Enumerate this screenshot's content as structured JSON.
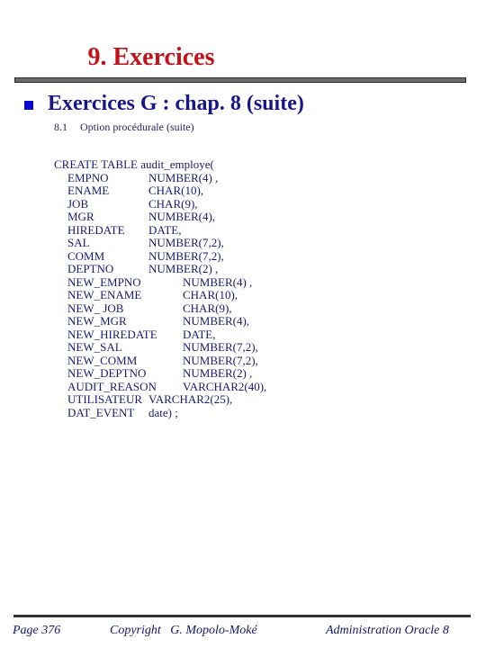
{
  "slide": {
    "title": "9. Exercices",
    "heading": "Exercices G : chap. 8 (suite)",
    "subsection": {
      "number": "8.1",
      "text": "Option procédurale (suite)"
    },
    "code": {
      "first_line": "CREATE TABLE audit_employe(",
      "columns": [
        {
          "name": "EMPNO",
          "type": "NUMBER(4) ,"
        },
        {
          "name": "ENAME",
          "type": "CHAR(10),"
        },
        {
          "name": "JOB",
          "type": "CHAR(9),"
        },
        {
          "name": "MGR",
          "type": "NUMBER(4),"
        },
        {
          "name": "HIREDATE",
          "type": "DATE,"
        },
        {
          "name": "SAL",
          "type": "NUMBER(7,2),"
        },
        {
          "name": "COMM",
          "type": "NUMBER(7,2),"
        },
        {
          "name": "DEPTNO",
          "type": "NUMBER(2) ,"
        },
        {
          "name": "NEW_EMPNO",
          "type": "NUMBER(4) ,"
        },
        {
          "name": "NEW_ENAME",
          "type": "CHAR(10),"
        },
        {
          "name": "NEW_ JOB",
          "type": "CHAR(9),"
        },
        {
          "name": "NEW_MGR",
          "type": "NUMBER(4),"
        },
        {
          "name": "NEW_HIREDATE",
          "type": "DATE,"
        },
        {
          "name": "NEW_SAL",
          "type": "NUMBER(7,2),"
        },
        {
          "name": "NEW_COMM",
          "type": "NUMBER(7,2),"
        },
        {
          "name": "NEW_DEPTNO",
          "type": "NUMBER(2) ,"
        },
        {
          "name": "AUDIT_REASON",
          "type": "VARCHAR2(40),"
        },
        {
          "name": "UTILISATEUR",
          "type": "VARCHAR2(25),"
        },
        {
          "name": "DAT_EVENT",
          "type": "date) ;"
        }
      ]
    }
  },
  "footer": {
    "page": "Page 376",
    "copyright": "Copyright   G. Mopolo-Moké",
    "course": "Administration Oracle 8"
  },
  "colors": {
    "title": "#c4121a",
    "heading": "#16168a",
    "bullet": "#0b0bd8"
  }
}
